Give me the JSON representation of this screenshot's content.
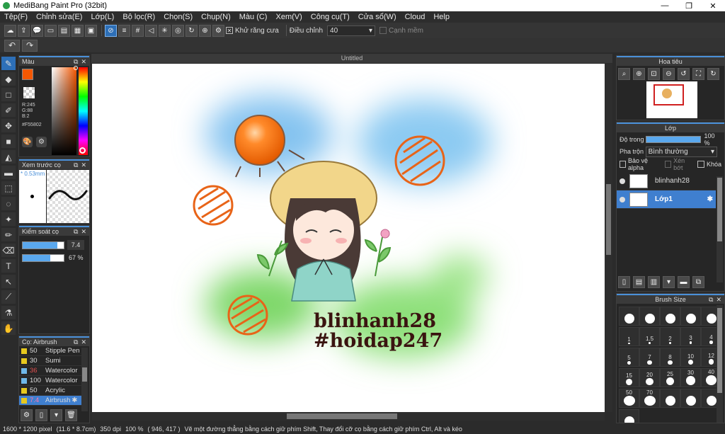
{
  "window": {
    "title": "MediBang Paint Pro (32bit)",
    "controls": [
      "—",
      "❐",
      "✕"
    ]
  },
  "menu": [
    "Tệp(F)",
    "Chỉnh sửa(E)",
    "Lớp(L)",
    "Bộ lọc(R)",
    "Chọn(S)",
    "Chụp(N)",
    "Màu (C)",
    "Xem(V)",
    "Công cụ(T)",
    "Cửa sổ(W)",
    "Cloud",
    "Help"
  ],
  "toolbar": {
    "antialias_label": "Khử răng cưa",
    "adjust_label": "Điều chỉnh",
    "adjust_value": "40",
    "soft_edge_label": "Cạnh mềm"
  },
  "color_panel": {
    "title": "Màu",
    "r": "R:245",
    "g": "G:88",
    "b": "B:2",
    "hex": "#F55802",
    "primary_color": "#F55802"
  },
  "preview_panel": {
    "title": "Xem trước cọ",
    "size": "0.53mm"
  },
  "brush_control": {
    "title": "Kiểm soát cọ",
    "size_value": "7.4",
    "opacity_value": "67 %"
  },
  "brush_list": {
    "title": "Cọ: Airbrush",
    "items": [
      {
        "size": "50",
        "name": "Stipple Pen",
        "color": "#e6c81e"
      },
      {
        "size": "30",
        "name": "Sumi",
        "color": "#e6c81e"
      },
      {
        "size": "36",
        "name": "Watercolor",
        "color": "#6fb7e8"
      },
      {
        "size": "100",
        "name": "Watercolor",
        "color": "#6fb7e8"
      },
      {
        "size": "50",
        "name": "Acrylic",
        "color": "#e6c81e"
      },
      {
        "size": "7.4",
        "name": "Airbrush",
        "color": "#e6c81e"
      }
    ]
  },
  "canvas": {
    "tab_title": "Untitled",
    "line1": "blinhanh28",
    "line2": "#hoidap247"
  },
  "navigator": {
    "title": "Hoa tiêu"
  },
  "layers": {
    "title": "Lớp",
    "opacity_label": "Độ trong",
    "opacity_value": "100 %",
    "blend_label": "Pha trộn",
    "blend_value": "Bình thường",
    "protect_alpha": "Bảo vệ alpha",
    "clipping": "Xén bớt",
    "lock": "Khóa",
    "items": [
      {
        "name": "blinhanh28",
        "selected": false
      },
      {
        "name": "Lớp1",
        "selected": true
      }
    ]
  },
  "brush_size": {
    "title": "Brush Size",
    "sizes": [
      "",
      "",
      "",
      "",
      "",
      "1",
      "1.5",
      "2",
      "3",
      "4",
      "5",
      "7",
      "8",
      "10",
      "12",
      "15",
      "20",
      "25",
      "30",
      "40",
      "50",
      "70",
      "",
      "",
      "",
      ""
    ]
  },
  "status": {
    "dimensions": "1600 * 1200 pixel",
    "physical": "(11.6 * 8.7cm)",
    "dpi": "350 dpi",
    "zoom": "100 %",
    "coords": "( 946, 417 )",
    "hint": "Vẽ một đường thẳng bằng cách giữ phím Shift, Thay đổi cỡ cọ bằng cách giữ phím Ctrl, Alt và kéo"
  }
}
